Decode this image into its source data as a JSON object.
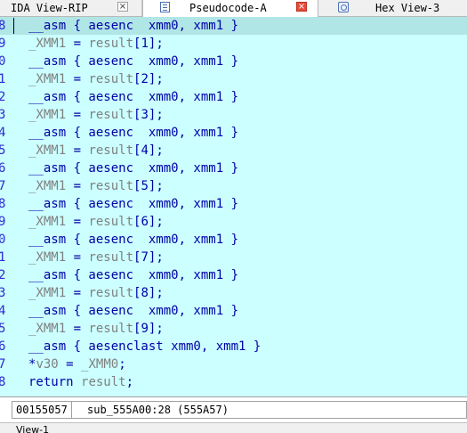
{
  "tabs": [
    {
      "label": "IDA View-RIP",
      "close": "×",
      "active": false
    },
    {
      "label": "Pseudocode-A",
      "close": "×",
      "active": true
    },
    {
      "label": "Hex View-3",
      "active": false
    }
  ],
  "code_lines": [
    {
      "num": "8",
      "segments": [
        {
          "t": "__asm { aesenc  xmm0, xmm1 }",
          "c": "kw"
        }
      ]
    },
    {
      "num": "9",
      "segments": [
        {
          "t": "_XMM1",
          "c": "var"
        },
        {
          "t": " = ",
          "c": "plain"
        },
        {
          "t": "result",
          "c": "var"
        },
        {
          "t": "[1];",
          "c": "plain"
        }
      ]
    },
    {
      "num": "0",
      "segments": [
        {
          "t": "__asm { aesenc  xmm0, xmm1 }",
          "c": "kw"
        }
      ]
    },
    {
      "num": "1",
      "segments": [
        {
          "t": "_XMM1",
          "c": "var"
        },
        {
          "t": " = ",
          "c": "plain"
        },
        {
          "t": "result",
          "c": "var"
        },
        {
          "t": "[2];",
          "c": "plain"
        }
      ]
    },
    {
      "num": "2",
      "segments": [
        {
          "t": "__asm { aesenc  xmm0, xmm1 }",
          "c": "kw"
        }
      ]
    },
    {
      "num": "3",
      "segments": [
        {
          "t": "_XMM1",
          "c": "var"
        },
        {
          "t": " = ",
          "c": "plain"
        },
        {
          "t": "result",
          "c": "var"
        },
        {
          "t": "[3];",
          "c": "plain"
        }
      ]
    },
    {
      "num": "4",
      "segments": [
        {
          "t": "__asm { aesenc  xmm0, xmm1 }",
          "c": "kw"
        }
      ]
    },
    {
      "num": "5",
      "segments": [
        {
          "t": "_XMM1",
          "c": "var"
        },
        {
          "t": " = ",
          "c": "plain"
        },
        {
          "t": "result",
          "c": "var"
        },
        {
          "t": "[4];",
          "c": "plain"
        }
      ]
    },
    {
      "num": "6",
      "segments": [
        {
          "t": "__asm { aesenc  xmm0, xmm1 }",
          "c": "kw"
        }
      ]
    },
    {
      "num": "7",
      "segments": [
        {
          "t": "_XMM1",
          "c": "var"
        },
        {
          "t": " = ",
          "c": "plain"
        },
        {
          "t": "result",
          "c": "var"
        },
        {
          "t": "[5];",
          "c": "plain"
        }
      ]
    },
    {
      "num": "8",
      "segments": [
        {
          "t": "__asm { aesenc  xmm0, xmm1 }",
          "c": "kw"
        }
      ]
    },
    {
      "num": "9",
      "segments": [
        {
          "t": "_XMM1",
          "c": "var"
        },
        {
          "t": " = ",
          "c": "plain"
        },
        {
          "t": "result",
          "c": "var"
        },
        {
          "t": "[6];",
          "c": "plain"
        }
      ]
    },
    {
      "num": "0",
      "segments": [
        {
          "t": "__asm { aesenc  xmm0, xmm1 }",
          "c": "kw"
        }
      ]
    },
    {
      "num": "1",
      "segments": [
        {
          "t": "_XMM1",
          "c": "var"
        },
        {
          "t": " = ",
          "c": "plain"
        },
        {
          "t": "result",
          "c": "var"
        },
        {
          "t": "[7];",
          "c": "plain"
        }
      ]
    },
    {
      "num": "2",
      "segments": [
        {
          "t": "__asm { aesenc  xmm0, xmm1 }",
          "c": "kw"
        }
      ]
    },
    {
      "num": "3",
      "segments": [
        {
          "t": "_XMM1",
          "c": "var"
        },
        {
          "t": " = ",
          "c": "plain"
        },
        {
          "t": "result",
          "c": "var"
        },
        {
          "t": "[8];",
          "c": "plain"
        }
      ]
    },
    {
      "num": "4",
      "segments": [
        {
          "t": "__asm { aesenc  xmm0, xmm1 }",
          "c": "kw"
        }
      ]
    },
    {
      "num": "5",
      "segments": [
        {
          "t": "_XMM1",
          "c": "var"
        },
        {
          "t": " = ",
          "c": "plain"
        },
        {
          "t": "result",
          "c": "var"
        },
        {
          "t": "[9];",
          "c": "plain"
        }
      ]
    },
    {
      "num": "6",
      "segments": [
        {
          "t": "__asm { aesenclast xmm0, xmm1 }",
          "c": "kw"
        }
      ]
    },
    {
      "num": "7",
      "segments": [
        {
          "t": "*",
          "c": "plain"
        },
        {
          "t": "v30",
          "c": "var"
        },
        {
          "t": " = ",
          "c": "plain"
        },
        {
          "t": "_XMM0",
          "c": "var"
        },
        {
          "t": ";",
          "c": "plain"
        }
      ]
    },
    {
      "num": "8",
      "segments": [
        {
          "t": "return ",
          "c": "kw"
        },
        {
          "t": "result",
          "c": "var"
        },
        {
          "t": ";",
          "c": "plain"
        }
      ]
    }
  ],
  "status": {
    "address": "00155057",
    "location": "sub_555A00:28 (555A57)"
  },
  "bottom_tab": {
    "label": "View-1"
  },
  "colors": {
    "code_bg": "#ccffff",
    "highlight_bg": "#b0e6e6",
    "keyword": "#0000a8",
    "variable": "#808080",
    "line_number": "#2b2bd6"
  },
  "icons": [
    "tab-close-icon",
    "pseudocode-icon",
    "hex-view-icon"
  ]
}
